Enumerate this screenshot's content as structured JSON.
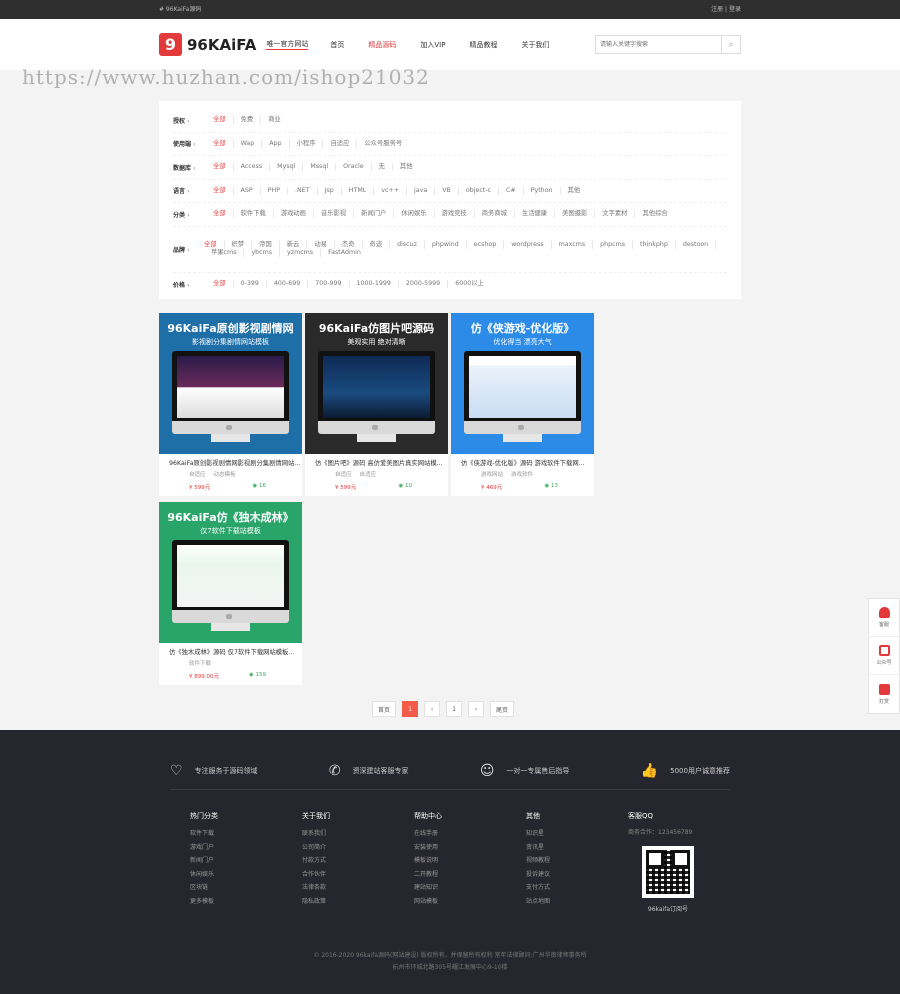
{
  "topbar": {
    "breadcrumb": "# 96KaiFa源码",
    "login": "注册",
    "register": "登录"
  },
  "header": {
    "logo_text": "96KAiFA",
    "slogan": "唯一官方网站",
    "nav": [
      "首页",
      "精品源码",
      "加入VIP",
      "精品教程",
      "关于我们"
    ],
    "search_placeholder": "请输入关键字搜索"
  },
  "watermark": "https://www.huzhan.com/ishop21032",
  "filters": [
    {
      "label": "授权",
      "options": [
        "全部",
        "免费",
        "商业"
      ]
    },
    {
      "label": "使用端",
      "options": [
        "全部",
        "Wap",
        "App",
        "小程序",
        "自适应",
        "公众号服务号"
      ]
    },
    {
      "label": "数据库",
      "options": [
        "全部",
        "Access",
        "Mysql",
        "Mssql",
        "Oracle",
        "无",
        "其他"
      ]
    },
    {
      "label": "语言",
      "options": [
        "全部",
        "ASP",
        "PHP",
        ".NET",
        "Jsp",
        "HTML",
        "vc++",
        "java",
        "VB",
        "object-c",
        "C#",
        "Python",
        "其他"
      ]
    },
    {
      "label": "分类",
      "options": [
        "全部",
        "软件下载",
        "游戏动画",
        "音乐影视",
        "新闻门户",
        "休闲娱乐",
        "游戏竞技",
        "商务商城",
        "生活健康",
        "美图摄影",
        "文字素材",
        "其他综合"
      ]
    },
    {
      "label": "品牌",
      "options": [
        "全部",
        "织梦",
        "帝国",
        "新云",
        "动易",
        "杰奇",
        "奇迹",
        "discuz",
        "phpwind",
        "ecshop",
        "wordpress",
        "maxcms",
        "phpcms",
        "thinkphp",
        "destoon",
        "苹果cms",
        "ybcms",
        "yzmcms",
        "FastAdmin"
      ]
    },
    {
      "label": "价格",
      "options": [
        "全部",
        "0-399",
        "400-699",
        "700-999",
        "1000-1999",
        "2000-5999",
        "6000以上"
      ]
    }
  ],
  "cards": [
    {
      "banner_title": "96KaiFa原创影视剧情网",
      "banner_sub": "影视剧分集剧情网站模板",
      "title": "96KaiFa原创影视剧情网影视剧分集剧情网站...",
      "tags": [
        "自适应",
        "动态模板"
      ],
      "price": "¥ 599元",
      "views": "16"
    },
    {
      "banner_title": "96KaiFa仿图片吧源码",
      "banner_sub": "美观实用  绝对清晰",
      "title": "仿《图片吧》源码 高仿爱美图片真实网站模...",
      "tags": [
        "自适应",
        "自适应"
      ],
      "price": "¥ 599元",
      "views": "10"
    },
    {
      "banner_title": "仿《侠游戏-优化版》",
      "banner_sub": "优化得当  漂亮大气",
      "title": "仿《侠游戏-优化版》源码 游戏软件下载网...",
      "tags": [
        "游戏网站",
        "游戏软件"
      ],
      "price": "¥ 469元",
      "views": "13"
    },
    {
      "banner_title": "96KaiFa仿《独木成林》",
      "banner_sub": "仅7软件下载站模板",
      "title": "仿《独木成林》源码 仅7软件下载网站模板...",
      "tags": [
        "软件下载"
      ],
      "price": "¥ 899.00元",
      "views": "159"
    }
  ],
  "pager": [
    "首页",
    "1",
    "‹",
    "1",
    "›",
    "尾页"
  ],
  "sidebar": [
    "客服",
    "公众号",
    "打赏"
  ],
  "features": [
    "专注服务于源码领域",
    "资深建站客服专家",
    "一对一专属售后指导",
    "5000用户诚意推荐"
  ],
  "footer_cols": [
    {
      "title": "热门分类",
      "items": [
        "软件下载",
        "游戏门户",
        "新闻门户",
        "休闲娱乐",
        "区块链",
        "更多模板"
      ]
    },
    {
      "title": "关于我们",
      "items": [
        "联系我们",
        "公司简介",
        "付款方式",
        "合作伙伴",
        "法律条款",
        "隐私政策"
      ]
    },
    {
      "title": "帮助中心",
      "items": [
        "在线手册",
        "安装使用",
        "模板说明",
        "二开教程",
        "建站知识",
        "网站模板"
      ]
    },
    {
      "title": "其他",
      "items": [
        "知识星",
        "资讯星",
        "视频教程",
        "投诉建议",
        "支付方式",
        "站点地图"
      ]
    }
  ],
  "qq": {
    "title": "客服QQ",
    "number": "商务合作：123456789",
    "caption": "96kaifa订阅号"
  },
  "copyright": [
    "© 2016-2020 96kaifa源码(网站建设) 版权所有，并保留所有权利 常年法律顾问:广州华南律师事务所",
    "杭州市环城北路305号耀江发展中心9-10楼"
  ],
  "colors": {
    "accent": "#e23a3a",
    "footer_bg": "#26262e",
    "card1": "#1e6fa8",
    "card2": "#2a2a2a",
    "card3": "#2c8be6",
    "card4": "#2aa56a"
  }
}
